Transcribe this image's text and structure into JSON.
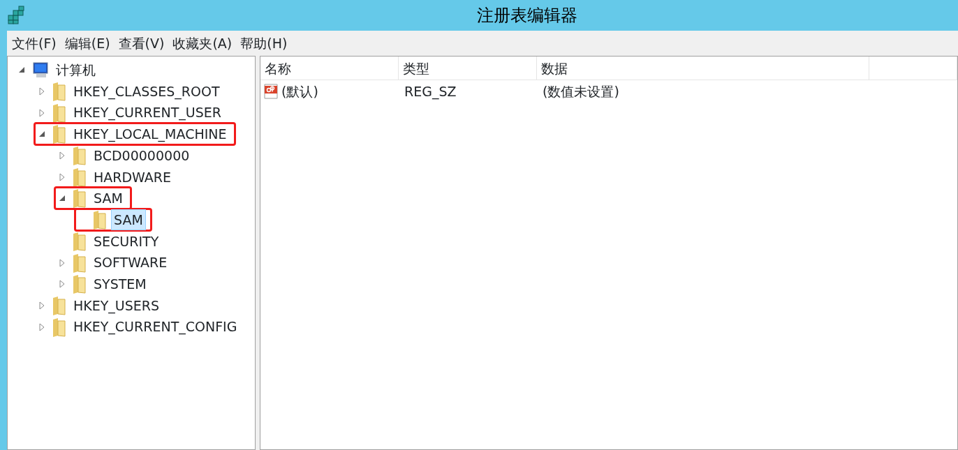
{
  "window": {
    "title": "注册表编辑器"
  },
  "menu": [
    "文件(F)",
    "编辑(E)",
    "查看(V)",
    "收藏夹(A)",
    "帮助(H)"
  ],
  "tree": [
    {
      "label": "计算机",
      "kind": "computer",
      "expanded": true,
      "selected": false,
      "highlighted": false,
      "children": [
        {
          "label": "HKEY_CLASSES_ROOT",
          "kind": "branch",
          "expanded": false,
          "selected": false,
          "highlighted": false
        },
        {
          "label": "HKEY_CURRENT_USER",
          "kind": "branch",
          "expanded": false,
          "selected": false,
          "highlighted": false
        },
        {
          "label": "HKEY_LOCAL_MACHINE",
          "kind": "branch",
          "expanded": true,
          "selected": false,
          "highlighted": true,
          "children": [
            {
              "label": "BCD00000000",
              "kind": "branch",
              "expanded": false,
              "selected": false,
              "highlighted": false
            },
            {
              "label": "HARDWARE",
              "kind": "branch",
              "expanded": false,
              "selected": false,
              "highlighted": false
            },
            {
              "label": "SAM",
              "kind": "branch",
              "expanded": true,
              "selected": false,
              "highlighted": true,
              "children": [
                {
                  "label": "SAM",
                  "kind": "leaf",
                  "selected": true,
                  "highlighted": true
                }
              ]
            },
            {
              "label": "SECURITY",
              "kind": "leaf",
              "selected": false,
              "highlighted": false
            },
            {
              "label": "SOFTWARE",
              "kind": "branch",
              "expanded": false,
              "selected": false,
              "highlighted": false
            },
            {
              "label": "SYSTEM",
              "kind": "branch",
              "expanded": false,
              "selected": false,
              "highlighted": false
            }
          ]
        },
        {
          "label": "HKEY_USERS",
          "kind": "branch",
          "expanded": false,
          "selected": false,
          "highlighted": false
        },
        {
          "label": "HKEY_CURRENT_CONFIG",
          "kind": "branch",
          "expanded": false,
          "selected": false,
          "highlighted": false
        }
      ]
    }
  ],
  "table": {
    "columns": [
      "名称",
      "类型",
      "数据"
    ],
    "rows": [
      {
        "name": "(默认)",
        "type": "REG_SZ",
        "data": "(数值未设置)"
      }
    ]
  }
}
